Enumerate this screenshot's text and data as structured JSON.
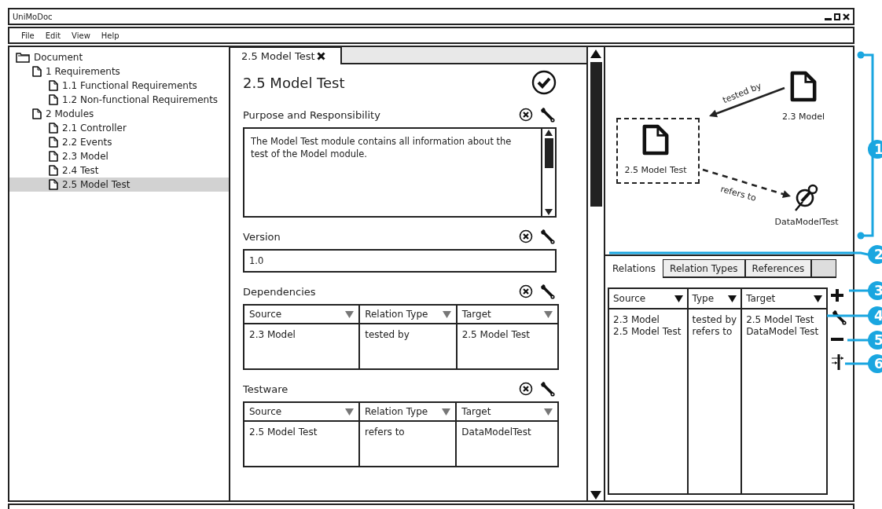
{
  "window": {
    "title": "UniMoDoc"
  },
  "menu": [
    "File",
    "Edit",
    "View",
    "Help"
  ],
  "tree": {
    "items": [
      {
        "label": "Document",
        "kind": "folder",
        "selected": false,
        "children": [
          {
            "label": "1 Requirements",
            "kind": "document",
            "selected": false,
            "children": [
              {
                "label": "1.1 Functional Requirements",
                "kind": "document",
                "selected": false
              },
              {
                "label": "1.2 Non-functional Requirements",
                "kind": "document",
                "selected": false
              }
            ]
          },
          {
            "label": "2 Modules",
            "kind": "document",
            "selected": false,
            "children": [
              {
                "label": "2.1 Controller",
                "kind": "document",
                "selected": false
              },
              {
                "label": "2.2 Events",
                "kind": "document",
                "selected": false
              },
              {
                "label": "2.3 Model",
                "kind": "document",
                "selected": false
              },
              {
                "label": "2.4 Test",
                "kind": "document",
                "selected": false
              },
              {
                "label": "2.5 Model Test",
                "kind": "document",
                "selected": true
              }
            ]
          }
        ]
      }
    ]
  },
  "editor": {
    "tabs": [
      {
        "label": "2.5 Model Test",
        "selected": true
      }
    ],
    "heading": "2.5 Model Test",
    "sections": [
      {
        "kind": "text-area",
        "title": "Purpose and Responsibility",
        "value": "The Model Test module contains all information about the test of the Model module."
      },
      {
        "kind": "field",
        "title": "Version",
        "value": "1.0"
      },
      {
        "kind": "table",
        "title": "Dependencies",
        "columns": [
          "Source",
          "Relation Type",
          "Target"
        ],
        "rows": [
          [
            "2.3 Model",
            "tested by",
            "2.5 Model Test"
          ]
        ]
      },
      {
        "kind": "table",
        "title": "Testware",
        "columns": [
          "Source",
          "Relation Type",
          "Target"
        ],
        "rows": [
          [
            "2.5 Model Test",
            "refers to",
            "DataModelTest"
          ]
        ]
      }
    ]
  },
  "graph": {
    "nodes": [
      {
        "kind": "document",
        "label": "2.3 Model",
        "selected": false
      },
      {
        "kind": "document",
        "label": "2.5 Model Test",
        "selected": true
      },
      {
        "kind": "pin",
        "label": "DataModelTest",
        "selected": false
      }
    ],
    "edges": [
      {
        "label": "tested by"
      },
      {
        "label": "refers to"
      }
    ]
  },
  "relations": {
    "tabs": [
      {
        "label": "Relations",
        "selected": true
      },
      {
        "label": "Relation Types",
        "selected": false
      },
      {
        "label": "References",
        "selected": false
      }
    ],
    "columns": [
      "Source",
      "Type",
      "Target"
    ],
    "rows": [
      [
        "2.3 Model",
        "tested by",
        "2.5 Model Test"
      ],
      [
        "2.5 Model Test",
        "refers to",
        "DataModel Test"
      ]
    ],
    "tools": [
      {
        "kind": "add"
      },
      {
        "kind": "edit"
      },
      {
        "kind": "remove"
      },
      {
        "kind": "split"
      }
    ]
  },
  "callouts": [
    "1",
    "2",
    "3",
    "4",
    "5",
    "6"
  ]
}
